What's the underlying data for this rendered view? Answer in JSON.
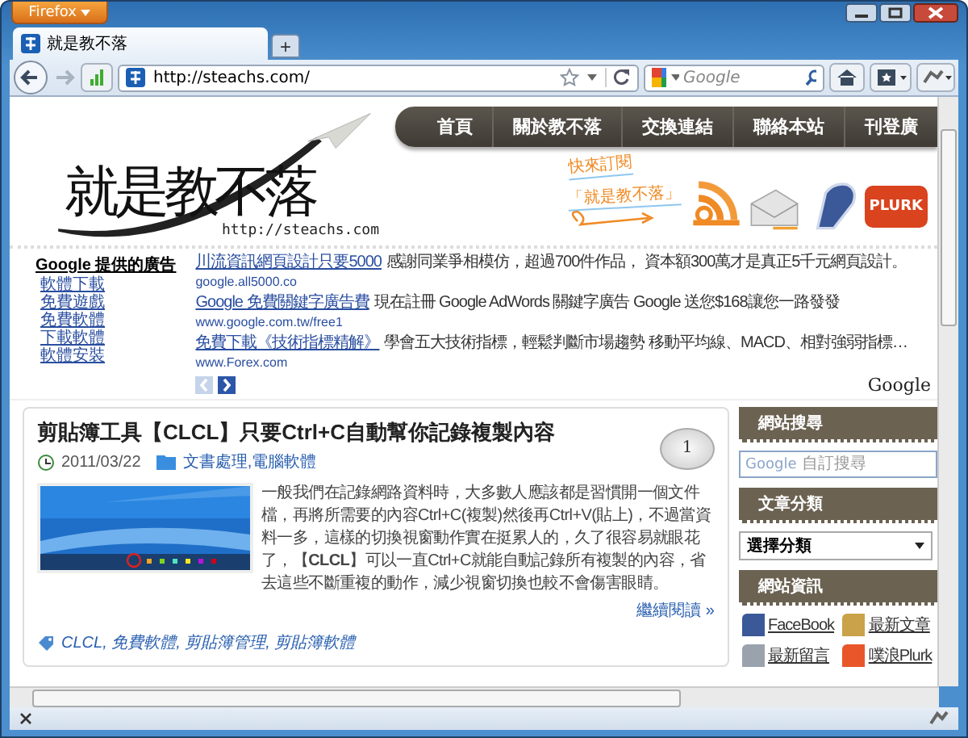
{
  "browser": {
    "menu_button": "Firefox",
    "tab": {
      "title": "就是教不落",
      "selected": true
    },
    "new_tab": "+",
    "address": "http://steachs.com/",
    "search_placeholder": "Google"
  },
  "site": {
    "logo": "就是教不落",
    "logo_url": "http://steachs.com",
    "nav": [
      {
        "label": "首頁"
      },
      {
        "label": "關於教不落"
      },
      {
        "label": "交換連結"
      },
      {
        "label": "聯絡本站"
      },
      {
        "label": "刊登廣"
      }
    ],
    "subscribe": [
      "快來訂閱",
      "「就是教不落」"
    ],
    "plurk_badge": "PLURK"
  },
  "ads": {
    "heading": "Google 提供的廣告",
    "links": [
      "軟體下載",
      "免費遊戲",
      "免費軟體",
      "下載軟體",
      "軟體安裝"
    ],
    "items": [
      {
        "title": "川流資訊網頁設計只要5000",
        "text": "感謝同業爭相模仿，超過700件作品， 資本額300萬才是真正5千元網頁設計。",
        "url": "google.all5000.co"
      },
      {
        "title": "Google 免費關鍵字廣告費",
        "text": "現在註冊 Google AdWords 關鍵字廣告 Google 送您$168讓您一路發發",
        "url": "www.google.com.tw/free1"
      },
      {
        "title": "免費下載《技術指標精解》",
        "text": "學會五大技術指標，輕鬆判斷市場趨勢 移動平均線、MACD、相對強弱指標…",
        "url": "www.Forex.com"
      }
    ],
    "brand": "Google"
  },
  "post": {
    "title": "剪貼簿工具【CLCL】只要Ctrl+C自動幫你記錄複製內容",
    "date": "2011/03/22",
    "categories": "文書處理,電腦軟體",
    "comments": "1",
    "body": "一般我們在記錄網路資料時，大多數人應該都是習慣開一個文件檔，再將所需要的內容Ctrl+C(複製)然後再Ctrl+V(貼上)，不過當資料一多，這樣的切換視窗動作實在挺累人的，久了很容易就眼花了，【**CLCL**】可以一直Ctrl+C就能自動記錄所有複製的內容，省去這些不斷重複的動作，減少視窗切換也較不會傷害眼睛。",
    "more": "繼續閱讀 »",
    "tags": "CLCL, 免費軟體, 剪貼簿管理, 剪貼簿軟體"
  },
  "sidebar": [
    {
      "kind": "search",
      "heading": "網站搜尋",
      "brand": "Google",
      "placeholder": "自訂搜尋"
    },
    {
      "kind": "select",
      "heading": "文章分類",
      "value": "選擇分類"
    },
    {
      "kind": "links",
      "heading": "網站資訊",
      "links": [
        "FaceBook",
        "最新文章",
        "最新留言",
        "噗浪Plurk"
      ]
    }
  ]
}
